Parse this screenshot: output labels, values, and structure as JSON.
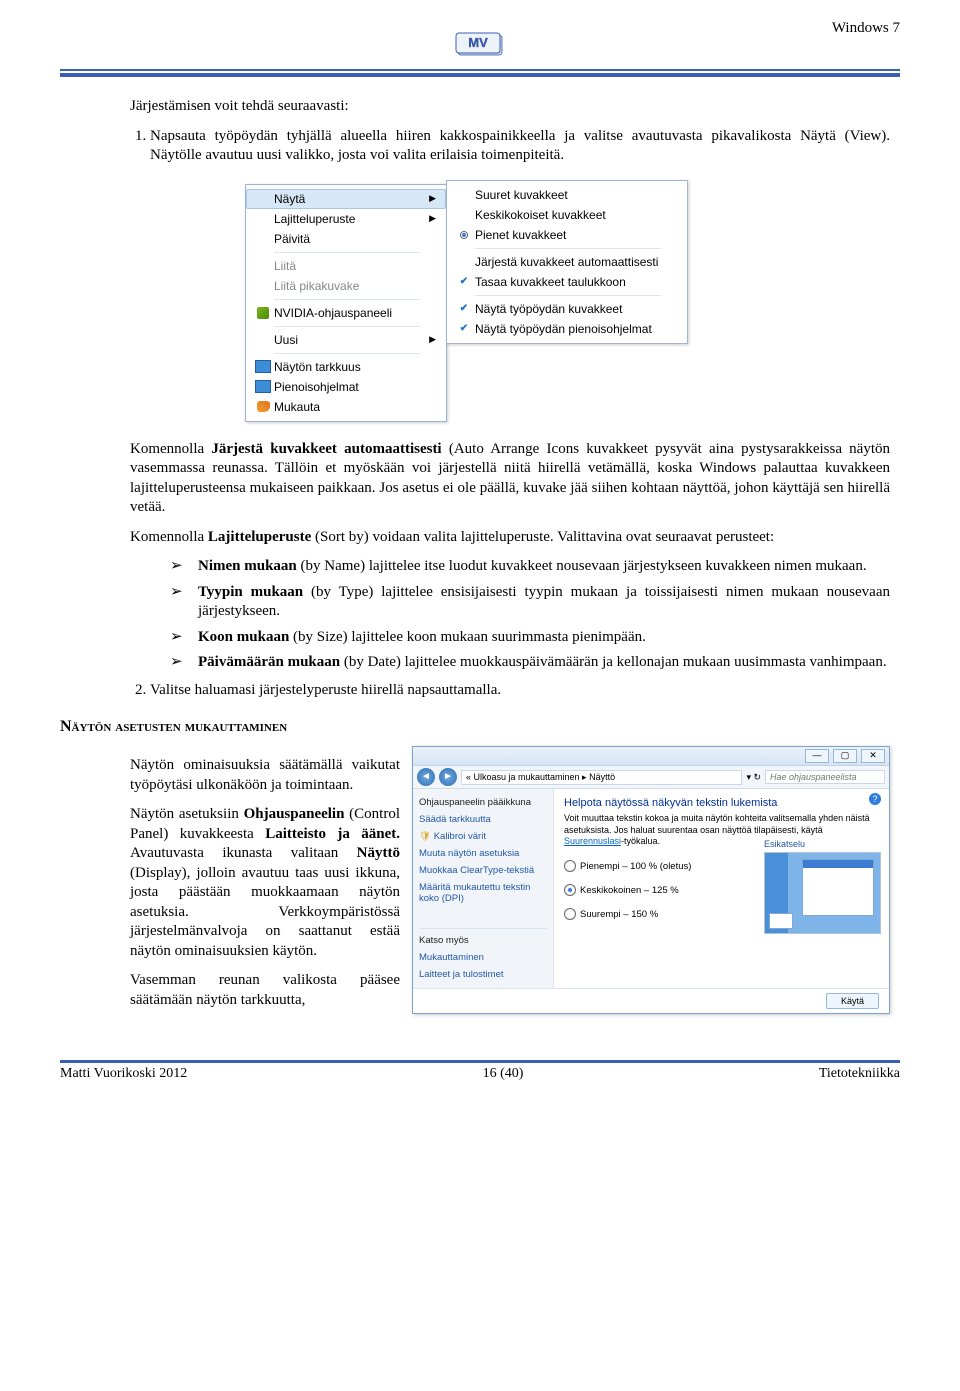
{
  "header": {
    "os_name": "Windows 7"
  },
  "body": {
    "intro": "Järjestämisen voit tehdä seuraavasti:",
    "step1": "Napsauta työpöydän tyhjällä alueella hiiren kakkospainikkeella ja valitse avautuvasta pikavalikosta Näytä (View). Näytölle avautuu uusi valikko, josta voi valita erilaisia toimenpiteitä.",
    "after_menu_p1_pre": "Komennolla ",
    "after_menu_p1_bold": "Järjestä kuvakkeet automaattisesti",
    "after_menu_p1_post": " (Auto Arrange Icons kuvakkeet pysyvät aina pystysarakkeissa näytön vasemmassa reunassa. Tällöin et myöskään voi järjestellä niitä hiirellä vetämällä, koska Windows palauttaa kuvakkeen lajitteluperusteensa mukaiseen paikkaan. Jos asetus ei ole päällä, kuvake jää siihen kohtaan näyttöä, johon käyttäjä sen hiirellä vetää.",
    "after_menu_p2_pre": "Komennolla ",
    "after_menu_p2_bold": "Lajitteluperuste",
    "after_menu_p2_post": " (Sort by) voidaan valita lajitteluperuste. Valittavina ovat seuraavat perusteet:",
    "bullets": {
      "b1_bold": "Nimen mukaan",
      "b1_rest": " (by Name) lajittelee itse luodut kuvakkeet nousevaan järjestykseen kuvakkeen nimen mukaan.",
      "b2_bold": "Tyypin mukaan",
      "b2_rest": " (by Type) lajittelee ensisijaisesti tyypin mukaan ja toissijaisesti nimen mukaan nousevaan järjestykseen.",
      "b3_bold": "Koon mukaan",
      "b3_rest": " (by Size) lajittelee koon mukaan suurimmasta pienimpään.",
      "b4_bold": "Päivämäärän mukaan",
      "b4_rest": " (by Date) lajittelee muokkauspäivämäärän ja kellonajan mukaan uusimmasta vanhimpaan."
    },
    "step2": "Valitse haluamasi järjestelyperuste hiirellä napsauttamalla.",
    "section_heading": "Näytön asetusten mukauttaminen",
    "col_p1": "Näytön ominaisuuksia säätämällä vaikutat työpöytäsi ulkonäköön ja toimintaan.",
    "col_p2_a": "Näytön asetuksiin ",
    "col_p2_b1": "Ohjauspaneelin",
    "col_p2_b": " (Control Panel) kuvakkeesta ",
    "col_p2_b2": "Laitteisto ja äänet.",
    "col_p2_c": " Avautuvasta ikunasta valitaan ",
    "col_p2_b3": "Näyttö",
    "col_p2_d": " (Display), jolloin avautuu taas uusi ikkuna, josta päästään muokkaamaan näytön asetuksia. Verkkoympäristössä järjestelmänvalvoja on saattanut estää näytön ominaisuuksien käytön.",
    "col_p3": "Vasemman reunan valikosta pääsee säätämään näytön tarkkuutta,"
  },
  "menu1": {
    "i1": "Näytä",
    "i2": "Lajitteluperuste",
    "i3": "Päivitä",
    "i4": "Liitä",
    "i5": "Liitä pikakuvake",
    "i6": "NVIDIA-ohjauspaneeli",
    "i7": "Uusi",
    "i8": "Näytön tarkkuus",
    "i9": "Pienoisohjelmat",
    "i10": "Mukauta"
  },
  "menu2": {
    "s1": "Suuret kuvakkeet",
    "s2": "Keskikokoiset kuvakkeet",
    "s3": "Pienet kuvakkeet",
    "s4": "Järjestä kuvakkeet automaattisesti",
    "s5": "Tasaa kuvakkeet taulukkoon",
    "s6": "Näytä työpöydän kuvakkeet",
    "s7": "Näytä työpöydän pienoisohjelmat"
  },
  "display_win": {
    "crumb": "« Ulkoasu ja mukauttaminen ▸ Näyttö",
    "search_ph": "Hae ohjauspaneelista",
    "sidebar_head": "Ohjauspaneelin pääikkuna",
    "side1": "Säädä tarkkuutta",
    "side2": "Kalibroi värit",
    "side3": "Muuta näytön asetuksia",
    "side4": "Muokkaa ClearType-tekstiä",
    "side5": "Määritä mukautettu tekstin koko (DPI)",
    "katso": "Katso myös",
    "k1": "Mukauttaminen",
    "k2": "Laitteet ja tulostimet",
    "main_h": "Helpota näytössä näkyvän tekstin lukemista",
    "main_desc_a": "Voit muuttaa tekstin kokoa ja muita näytön kohteita valitsemalla yhden näistä asetuksista. Jos haluat suurentaa osan näyttöä tilapäisesti, käytä ",
    "main_desc_link": "Suurennuslasi",
    "main_desc_b": "-työkalua.",
    "r1": "Pienempi – 100 % (oletus)",
    "r2": "Keskikokoinen – 125 %",
    "r3": "Suurempi – 150 %",
    "preview": "Esikatselu",
    "apply": "Käytä"
  },
  "footer": {
    "left": "Matti Vuorikoski 2012",
    "center": "16 (40)",
    "right": "Tietotekniikka"
  }
}
